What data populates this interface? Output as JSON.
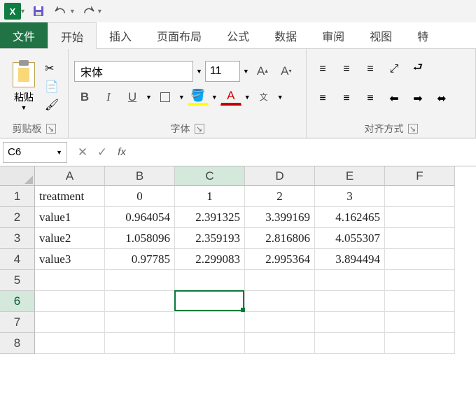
{
  "qat": {
    "save_tip": "save",
    "undo_tip": "undo",
    "redo_tip": "redo"
  },
  "tabs": {
    "file": "文件",
    "home": "开始",
    "insert": "插入",
    "layout": "页面布局",
    "formulas": "公式",
    "data": "数据",
    "review": "审阅",
    "view": "视图",
    "extra": "特"
  },
  "ribbon": {
    "clipboard": {
      "paste": "粘贴",
      "label": "剪贴板"
    },
    "font": {
      "name": "宋体",
      "size": "11",
      "label": "字体",
      "bold": "B",
      "italic": "I",
      "underline": "U",
      "fontcolor": "A",
      "ruby": "wén"
    },
    "align": {
      "label": "对齐方式"
    }
  },
  "nameBox": "C6",
  "formula": "",
  "columns": [
    "A",
    "B",
    "C",
    "D",
    "E",
    "F"
  ],
  "rows": [
    "1",
    "2",
    "3",
    "4",
    "5",
    "6",
    "7",
    "8"
  ],
  "sheet": {
    "A1": "treatment",
    "B1": "0",
    "C1": "1",
    "D1": "2",
    "E1": "3",
    "A2": "value1",
    "B2": "0.964054",
    "C2": "2.391325",
    "D2": "3.399169",
    "E2": "4.162465",
    "A3": "value2",
    "B3": "1.058096",
    "C3": "2.359193",
    "D3": "2.816806",
    "E3": "4.055307",
    "A4": "value3",
    "B4": "0.97785",
    "C4": "2.299083",
    "D4": "2.995364",
    "E4": "3.894494"
  },
  "selection": {
    "col": "C",
    "row": "6"
  }
}
